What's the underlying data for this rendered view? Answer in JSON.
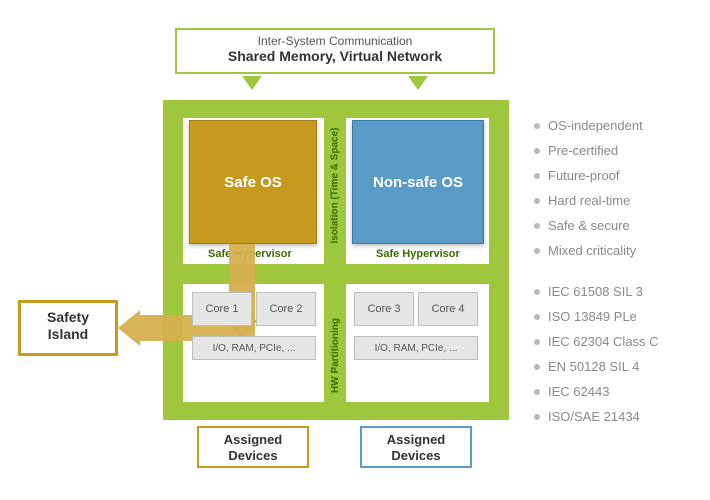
{
  "banner": {
    "line1": "Inter-System Communication",
    "line2": "Shared Memory, Virtual Network"
  },
  "os": {
    "safe": "Safe OS",
    "nonsafe": "Non-safe OS"
  },
  "center_label": "Isolation (Time & Space)",
  "bottom_center_label": "HW Partitioning",
  "hypervisor": {
    "left": "Safe Hypervisor",
    "right": "Safe Hypervisor"
  },
  "hw": {
    "left_cores": [
      "Core 1",
      "Core 2"
    ],
    "right_cores": [
      "Core 3",
      "Core 4"
    ],
    "left_io": "I/O, RAM, PCIe, ...",
    "right_io": "I/O, RAM, PCIe, ..."
  },
  "assigned": {
    "left_l1": "Assigned",
    "left_l2": "Devices",
    "right_l1": "Assigned",
    "right_l2": "Devices"
  },
  "island": {
    "l1": "Safety",
    "l2": "Island"
  },
  "features": [
    "OS-independent",
    "Pre-certified",
    "Future-proof",
    "Hard real-time",
    "Safe & secure",
    "Mixed criticality"
  ],
  "standards": [
    "IEC 61508 SIL 3",
    "ISO 13849 PLe",
    "IEC 62304 Class C",
    "EN 50128 SIL 4",
    "IEC 62443",
    "ISO/SAE 21434"
  ],
  "colors": {
    "green": "#9ec73d",
    "ochre": "#c69a1f",
    "blue": "#5a9bc8",
    "grey": "#8a8a8a"
  }
}
